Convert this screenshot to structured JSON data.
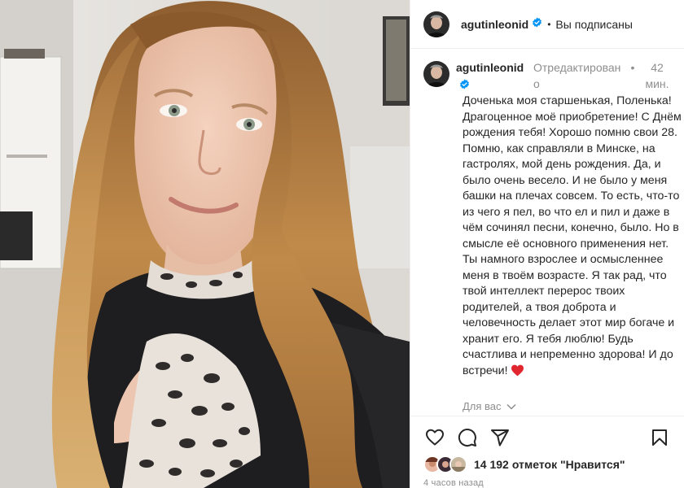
{
  "post": {
    "username": "agutinleonid",
    "follow_status": "Вы подписаны",
    "separator": "•"
  },
  "caption": {
    "username": "agutinleonid",
    "edited_label": "Отредактировано",
    "separator": "•",
    "time": "42 мин.",
    "text": "Доченька моя старшенькая, Поленька! Драгоценное моё приобретение! С Днём рождения тебя! Хорошо помню свои 28. Помню, как справляли в Минске, на гастролях, мой день рождения. Да, и было очень весело. И не было у меня башки на плечах совсем. То есть, что-то из чего я пел, во что ел и пил и даже в чём сочинял песни, конечно, было. Но в смысле её основного применения нет. Ты намного взрослее и осмысленнее меня в твоём возрасте. Я так рад, что твой интеллект перерос твоих родителей, а твоя доброта и человечность делает этот мир богаче и хранит его. Я тебя люблю! Будь счастлива и непременно здорова! И до встречи!",
    "emoji": "red-heart"
  },
  "translate_label": "Для вас",
  "actions": {
    "like_icon": "heart-outline-icon",
    "comment_icon": "comment-bubble-icon",
    "share_icon": "paper-plane-icon",
    "save_icon": "bookmark-icon"
  },
  "likes": {
    "count": "14 192",
    "text": "отметок \"Нравится\""
  },
  "posted_ago": "4 часов назад",
  "colors": {
    "verified_blue": "#0095f6",
    "text_primary": "#262626",
    "text_secondary": "#8e8e8e",
    "heart_red": "#ed4956"
  }
}
